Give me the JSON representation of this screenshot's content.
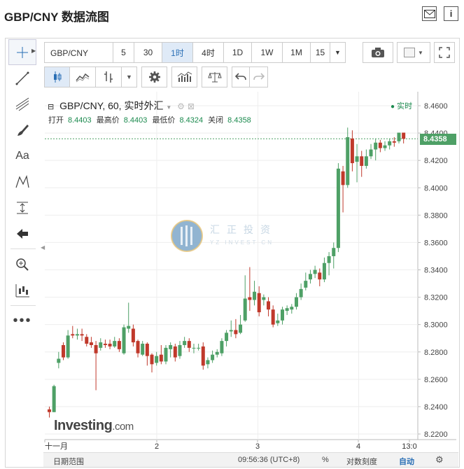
{
  "header": {
    "title": "GBP/CNY 数据流图",
    "mail_icon": "mail-icon",
    "info_icon": "info-icon"
  },
  "toolbar": {
    "symbol": "GBP/CNY",
    "intervals": [
      "5",
      "30",
      "1时",
      "4时",
      "1D",
      "1W",
      "1M",
      "15"
    ],
    "active_interval": "1时"
  },
  "legend": {
    "title": "GBP/CNY, 60, 实时外汇",
    "open_label": "打开",
    "open_value": "8.4403",
    "high_label": "最高价",
    "high_value": "8.4403",
    "low_label": "最低价",
    "low_value": "8.4324",
    "close_label": "关闭",
    "close_value": "8.4358",
    "realtime": "实时"
  },
  "watermark": {
    "text": "汇正投资",
    "sub": "YZ INVEST CN"
  },
  "brand": {
    "name": "Investing",
    "suffix": ".com"
  },
  "chart_data": {
    "type": "candlestick",
    "symbol": "GBP/CNY",
    "interval": "60",
    "ylim": [
      8.22,
      8.46
    ],
    "y_ticks": [
      "8.4600",
      "8.4400",
      "8.4200",
      "8.4000",
      "8.3800",
      "8.3600",
      "8.3400",
      "8.3200",
      "8.3000",
      "8.2800",
      "8.2600",
      "8.2400",
      "8.2200"
    ],
    "x_ticks": [
      "十一月",
      "2",
      "3",
      "4",
      "13:0"
    ],
    "last_price": "8.4358",
    "colors": {
      "up": "#4ea066",
      "down": "#c0392b"
    },
    "candles": [
      [
        8.238,
        8.236,
        8.24,
        8.232
      ],
      [
        8.236,
        8.255,
        8.256,
        8.236
      ],
      [
        8.272,
        8.275,
        8.28,
        8.268
      ],
      [
        8.285,
        8.276,
        8.287,
        8.274
      ],
      [
        8.276,
        8.292,
        8.296,
        8.275
      ],
      [
        8.293,
        8.292,
        8.299,
        8.29
      ],
      [
        8.292,
        8.293,
        8.297,
        8.289
      ],
      [
        8.293,
        8.292,
        8.297,
        8.288
      ],
      [
        8.291,
        8.286,
        8.293,
        8.284
      ],
      [
        8.287,
        8.285,
        8.291,
        8.283
      ],
      [
        8.285,
        8.279,
        8.288,
        8.252
      ],
      [
        8.283,
        8.287,
        8.29,
        8.281
      ],
      [
        8.286,
        8.285,
        8.289,
        8.283
      ],
      [
        8.286,
        8.284,
        8.289,
        8.282
      ],
      [
        8.284,
        8.288,
        8.291,
        8.283
      ],
      [
        8.288,
        8.282,
        8.29,
        8.28
      ],
      [
        8.279,
        8.298,
        8.3,
        8.278
      ],
      [
        8.297,
        8.299,
        8.316,
        8.294
      ],
      [
        8.297,
        8.287,
        8.3,
        8.284
      ],
      [
        8.288,
        8.279,
        8.289,
        8.276
      ],
      [
        8.278,
        8.286,
        8.288,
        8.277
      ],
      [
        8.286,
        8.277,
        8.287,
        8.27
      ],
      [
        8.278,
        8.271,
        8.279,
        8.265
      ],
      [
        8.272,
        8.277,
        8.28,
        8.27
      ],
      [
        8.278,
        8.273,
        8.285,
        8.271
      ],
      [
        8.273,
        8.283,
        8.285,
        8.271
      ],
      [
        8.282,
        8.285,
        8.287,
        8.276
      ],
      [
        8.284,
        8.276,
        8.286,
        8.273
      ],
      [
        8.277,
        8.285,
        8.288,
        8.275
      ],
      [
        8.285,
        8.288,
        8.291,
        8.283
      ],
      [
        8.288,
        8.283,
        8.29,
        8.28
      ],
      [
        8.283,
        8.283,
        8.286,
        8.279
      ],
      [
        8.283,
        8.283,
        8.286,
        8.281
      ],
      [
        8.284,
        8.27,
        8.287,
        8.267
      ],
      [
        8.271,
        8.274,
        8.276,
        8.268
      ],
      [
        8.274,
        8.278,
        8.281,
        8.272
      ],
      [
        8.278,
        8.28,
        8.282,
        8.276
      ],
      [
        8.279,
        8.288,
        8.29,
        8.277
      ],
      [
        8.288,
        8.294,
        8.296,
        8.284
      ],
      [
        8.295,
        8.296,
        8.303,
        8.291
      ],
      [
        8.296,
        8.293,
        8.304,
        8.29
      ],
      [
        8.294,
        8.3,
        8.307,
        8.293
      ],
      [
        8.303,
        8.319,
        8.336,
        8.302
      ],
      [
        8.32,
        8.318,
        8.342,
        8.31
      ],
      [
        8.318,
        8.324,
        8.332,
        8.314
      ],
      [
        8.323,
        8.309,
        8.328,
        8.306
      ],
      [
        8.318,
        8.32,
        8.322,
        8.314
      ],
      [
        8.317,
        8.311,
        8.32,
        8.306
      ],
      [
        8.311,
        8.3,
        8.314,
        8.298
      ],
      [
        8.301,
        8.303,
        8.308,
        8.299
      ],
      [
        8.303,
        8.311,
        8.313,
        8.3
      ],
      [
        8.31,
        8.312,
        8.314,
        8.307
      ],
      [
        8.311,
        8.313,
        8.315,
        8.308
      ],
      [
        8.313,
        8.32,
        8.323,
        8.311
      ],
      [
        8.32,
        8.326,
        8.33,
        8.318
      ],
      [
        8.327,
        8.332,
        8.338,
        8.325
      ],
      [
        8.333,
        8.337,
        8.34,
        8.33
      ],
      [
        8.337,
        8.34,
        8.343,
        8.334
      ],
      [
        8.338,
        8.333,
        8.341,
        8.328
      ],
      [
        8.333,
        8.345,
        8.349,
        8.331
      ],
      [
        8.345,
        8.35,
        8.353,
        8.336
      ],
      [
        8.35,
        8.356,
        8.36,
        8.341
      ],
      [
        8.356,
        8.414,
        8.418,
        8.353
      ],
      [
        8.412,
        8.402,
        8.416,
        8.382
      ],
      [
        8.402,
        8.437,
        8.444,
        8.4
      ],
      [
        8.436,
        8.418,
        8.442,
        8.412
      ],
      [
        8.419,
        8.423,
        8.432,
        8.404
      ],
      [
        8.423,
        8.416,
        8.427,
        8.408
      ],
      [
        8.416,
        8.423,
        8.428,
        8.414
      ],
      [
        8.423,
        8.428,
        8.432,
        8.421
      ],
      [
        8.428,
        8.433,
        8.436,
        8.42
      ],
      [
        8.433,
        8.429,
        8.435,
        8.426
      ],
      [
        8.429,
        8.431,
        8.434,
        8.427
      ],
      [
        8.431,
        8.434,
        8.436,
        8.428
      ],
      [
        8.434,
        8.433,
        8.437,
        8.43
      ],
      [
        8.434,
        8.4403,
        8.4403,
        8.4324
      ],
      [
        8.4403,
        8.4358,
        8.4403,
        8.4324
      ]
    ]
  },
  "statusbar": {
    "date_range": "日期范围",
    "time": "09:56:36 (UTC+8)",
    "percent": "%",
    "log": "对数刻度",
    "auto": "自动"
  }
}
